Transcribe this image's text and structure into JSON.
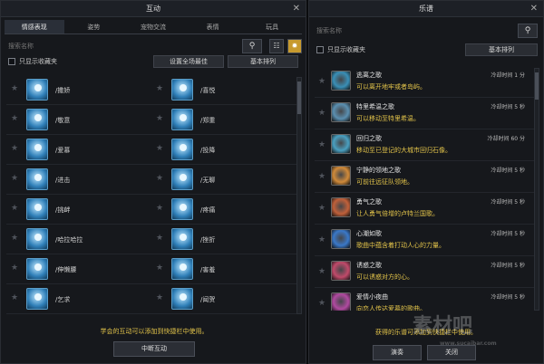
{
  "left": {
    "title": "互动",
    "close": "✕",
    "tabs": [
      "情感表现",
      "姿势",
      "宠物交流",
      "表情",
      "玩具"
    ],
    "search_placeholder": "搜索名称",
    "search_icon": "magnifier-icon",
    "view_icon": "grid-icon",
    "sun_icon": "sun-icon",
    "show_favorites": "只显示收藏夹",
    "set_global_favorite": "设置全场最佳",
    "basic_sort": "基本排列",
    "emotes": [
      [
        "/撒娇",
        "/喜悦"
      ],
      [
        "/敬意",
        "/郑重"
      ],
      [
        "/爱慕",
        "/投降"
      ],
      [
        "/进击",
        "/无聊"
      ],
      [
        "/挑衅",
        "/疼痛"
      ],
      [
        "/哈拉哈拉",
        "/挫折"
      ],
      [
        "/伸懒腰",
        "/害羞"
      ],
      [
        "/乞求",
        "/闻贺"
      ]
    ],
    "note": "学会的互动可以添加到快捷栏中使用。",
    "stop_button": "中断互动"
  },
  "right": {
    "title": "乐谱",
    "close": "✕",
    "search_placeholder": "搜索名称",
    "search_icon": "magnifier-icon",
    "show_favorites": "只显示收藏夹",
    "basic_sort": "基本排列",
    "songs": [
      {
        "name": "逃离之歌",
        "desc": "可以离开地牢或者岛屿。",
        "cooldown": "冷却时间 1 分",
        "color": "#3a8fb6"
      },
      {
        "name": "特里希温之歌",
        "desc": "可以移动至特里希温。",
        "cooldown": "冷却时间 5 秒",
        "color": "#5b8fb0"
      },
      {
        "name": "回归之歌",
        "desc": "移动至已登记的大城市回归石像。",
        "cooldown": "冷却时间 60 分",
        "color": "#4a9fc0"
      },
      {
        "name": "宁静的领地之歌",
        "desc": "可前往远征队领地。",
        "cooldown": "冷却时间 5 秒",
        "color": "#d08a3a"
      },
      {
        "name": "勇气之歌",
        "desc": "让人勇气倍增的卢特兰国歌。",
        "cooldown": "冷却时间 5 秒",
        "color": "#c0603a"
      },
      {
        "name": "心潮如歌",
        "desc": "歌曲中蕴含着打动人心的力量。",
        "cooldown": "冷却时间 5 秒",
        "color": "#3a78c8"
      },
      {
        "name": "诱惑之歌",
        "desc": "可以诱惑对方的心。",
        "cooldown": "冷却时间 5 秒",
        "color": "#c04a6a"
      },
      {
        "name": "爱情小夜曲",
        "desc": "向恋人传达爱慕的歌曲。",
        "cooldown": "冷却时间 5 秒",
        "color": "#b04aa0"
      }
    ],
    "note": "获得的乐谱可添加到快捷栏中使用。",
    "play_button": "演奏",
    "close_button": "关闭"
  },
  "watermark": {
    "text": "素材吧",
    "url": "www.sucaibar.com"
  }
}
